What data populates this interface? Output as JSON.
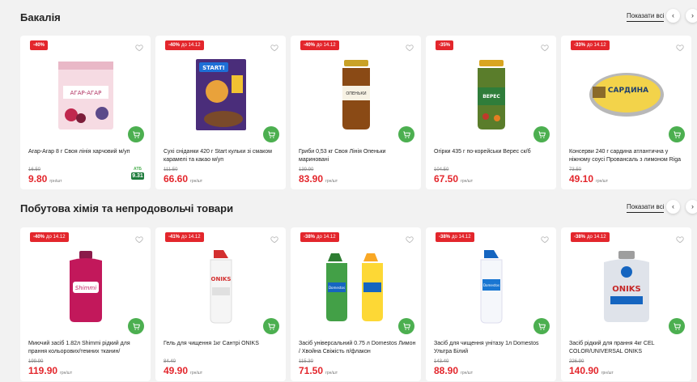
{
  "sections": [
    {
      "title": "Бакалія",
      "show_all": "Показати всі",
      "products": [
        {
          "badge": "-40%",
          "until": "",
          "name": "Агар-Агар 8 г Своя лінія харчовий м/уп",
          "old_price": "16.50",
          "price": "9.80",
          "currency": "грн/шт",
          "atb_label": "АТБ",
          "atb_price": "9.31"
        },
        {
          "badge": "-40%",
          "until": "до 14.12",
          "name": "Сухі сніданки 420 г Start кульки зі смаком карамелі та какао м/уп",
          "old_price": "111.50",
          "price": "66.60",
          "currency": "грн/шт",
          "atb_label": "",
          "atb_price": ""
        },
        {
          "badge": "-40%",
          "until": "до 14.12",
          "name": "Гриби 0,53 кг Своя Лінія Опеньки мариновані",
          "old_price": "139.90",
          "price": "83.90",
          "currency": "грн/шт",
          "atb_label": "",
          "atb_price": ""
        },
        {
          "badge": "-35%",
          "until": "",
          "name": "Огірки 435 г по-корейськи Верес ск/б",
          "old_price": "104.50",
          "price": "67.50",
          "currency": "грн/шт",
          "atb_label": "",
          "atb_price": ""
        },
        {
          "badge": "-33%",
          "until": "до 14.12",
          "name": "Консерви 240 г сардина атлантична у ніжному соусі Провансаль з лимоном Riga Gold ж/б",
          "old_price": "73.50",
          "price": "49.10",
          "currency": "грн/шт",
          "atb_label": "",
          "atb_price": ""
        }
      ]
    },
    {
      "title": "Побутова хімія та непродовольчі товари",
      "show_all": "Показати всі",
      "products": [
        {
          "badge": "-40%",
          "until": "до 14.12",
          "name": "Миючий засіб 1.82л Shimmi рідкий для прання кольорових/темних тканин/універсальний п...",
          "old_price": "199.90",
          "price": "119.90",
          "currency": "грн/шт",
          "atb_label": "",
          "atb_price": ""
        },
        {
          "badge": "-41%",
          "until": "до 14.12",
          "name": "Гель для чищення 1кг Сантрі ONIKS",
          "old_price": "84.40",
          "price": "49.90",
          "currency": "грн/шт",
          "atb_label": "",
          "atb_price": ""
        },
        {
          "badge": "-38%",
          "until": "до 14.12",
          "name": "Засіб універсальний 0.75 л Domestos Лимон / Хвойна Свіжість п/флакон",
          "old_price": "115.30",
          "price": "71.50",
          "currency": "грн/шт",
          "atb_label": "",
          "atb_price": ""
        },
        {
          "badge": "-38%",
          "until": "до 14.12",
          "name": "Засіб для чищення унітазу 1л Domestos Ультра Білий",
          "old_price": "143.40",
          "price": "88.90",
          "currency": "грн/шт",
          "atb_label": "",
          "atb_price": ""
        },
        {
          "badge": "-38%",
          "until": "до 14.12",
          "name": "Засіб рідкий для прання 4кг CEL COLOR/UNIVERSAL ONIKS",
          "old_price": "226.90",
          "price": "140.90",
          "currency": "грн/шт",
          "atb_label": "",
          "atb_price": ""
        }
      ]
    }
  ],
  "images": [
    [
      "agar-package",
      "cereal-box",
      "mushroom-jar",
      "pickle-jar",
      "sardine-can"
    ],
    [
      "detergent-bottle",
      "cleaner-bottle-white",
      "domestos-pair",
      "domestos-bottle",
      "liquid-detergent-jug"
    ]
  ],
  "image_text": {
    "agar": "АГАР-АГАР",
    "cereal": "START!",
    "mushroom": "ОПЕНЬКИ",
    "pickle": "ВЕРЕС",
    "sardine": "САРДИНА",
    "shimmi": "Shimmi",
    "oniks": "ONIKS",
    "domestos": "Domestos"
  },
  "colors": {
    "accent": "#e3262c",
    "cart": "#4caf50",
    "atb": "#1e7b3c"
  }
}
